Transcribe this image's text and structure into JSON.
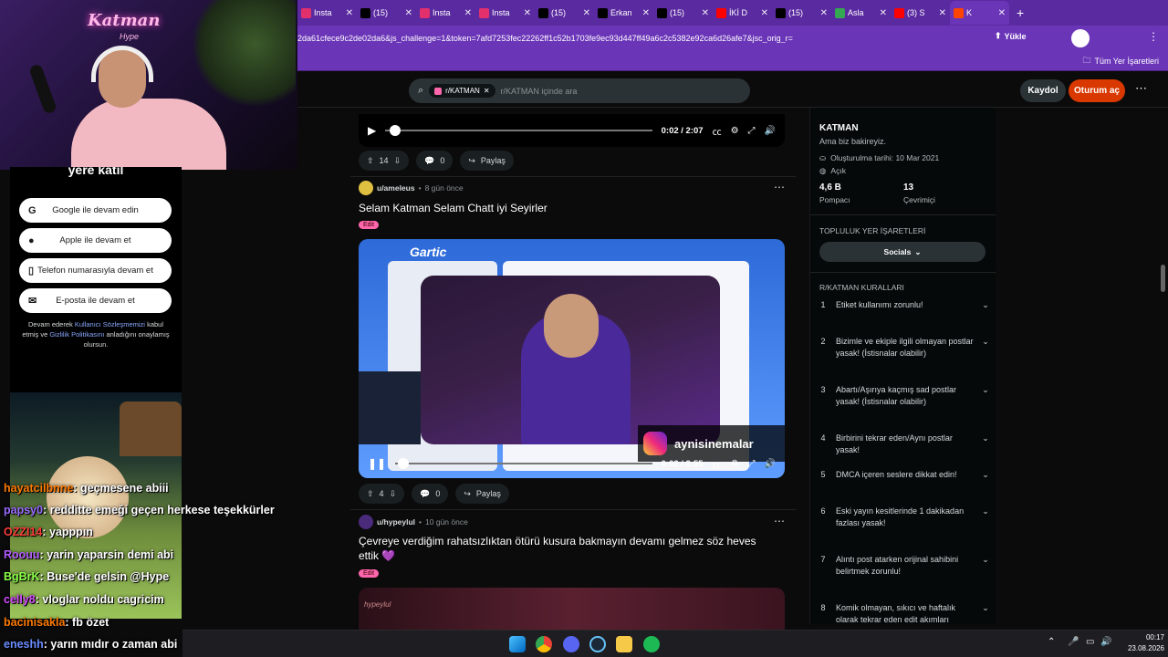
{
  "browser": {
    "tabs": [
      {
        "label": "Insta",
        "icon": "instagram-icon",
        "color": "#e1306c"
      },
      {
        "label": "(15)",
        "icon": "x-icon",
        "color": "#000000"
      },
      {
        "label": "Insta",
        "icon": "instagram-icon",
        "color": "#e1306c"
      },
      {
        "label": "Insta",
        "icon": "instagram-icon",
        "color": "#e1306c"
      },
      {
        "label": "(15)",
        "icon": "x-icon",
        "color": "#000000"
      },
      {
        "label": "Erkan",
        "icon": "tiktok-icon",
        "color": "#000000"
      },
      {
        "label": "(15)",
        "icon": "x-icon",
        "color": "#000000"
      },
      {
        "label": "İKİ D",
        "icon": "youtube-icon",
        "color": "#ff0000"
      },
      {
        "label": "(15)",
        "icon": "x-icon",
        "color": "#000000"
      },
      {
        "label": "Asla",
        "icon": "map-icon",
        "color": "#34a853"
      },
      {
        "label": "(3) S",
        "icon": "youtube-icon",
        "color": "#ff0000"
      },
      {
        "label": "K",
        "icon": "reddit-icon",
        "color": "#ff4500"
      }
    ],
    "url": "2da61cfece9c2de02da6&js_challenge=1&token=7afd7253fec22262ff1c52b1703fe9ec93d447ff49a6c2c5382e92ca6d26afe7&jsc_orig_r=",
    "upload_label": "Yükle",
    "bookmarks_label": "Tüm Yer İşaretleri"
  },
  "header": {
    "search_chip": "r/KATMAN",
    "search_placeholder": "r/KATMAN içinde ara",
    "signup_label": "Kaydol",
    "login_label": "Oturum aç"
  },
  "feed": {
    "top_player": {
      "time": "0:02 / 2:07",
      "progress": 0.016
    },
    "top_actions": {
      "votes": "14",
      "comments": "0",
      "share": "Paylaş"
    },
    "posts": [
      {
        "user": "u/ameleus",
        "age": "8 gün önce",
        "title": "Selam Katman Selam Chatt iyi Seyirler",
        "flair": "Edit",
        "video_watermark": "aynisinemalar",
        "player_time": "0:02 / 3:55",
        "progress": 0.009,
        "votes": "4",
        "comments": "0",
        "share": "Paylaş"
      },
      {
        "user": "u/hypeylul",
        "age": "10 gün önce",
        "title": "Çevreye verdiğim rahatsızlıktan ötürü kusura bakmayın devamı gelmez söz heves ettik 💜",
        "flair": "Edit",
        "preview_label": "hypeylul"
      }
    ]
  },
  "sidebar": {
    "community_name": "KATMAN",
    "tagline": "Ama biz bakireyiz.",
    "created": "Oluşturulma tarihi: 10 Mar 2021",
    "visibility": "Açık",
    "members_value": "4,6 B",
    "members_label": "Pompacı",
    "online_value": "13",
    "online_label": "Çevrimiçi",
    "bookmarks_title": "TOPLULUK YER İŞARETLERİ",
    "socials_label": "Socials",
    "rules_title": "R/KATMAN KURALLARI",
    "rules": [
      {
        "n": "1",
        "text": "Etiket kullanımı zorunlu!"
      },
      {
        "n": "2",
        "text": "Bizimle ve ekiple ilgili olmayan postlar yasak! (İstisnalar olabilir)"
      },
      {
        "n": "3",
        "text": "Abartı/Aşırıya kaçmış sad postlar yasak! (İstisnalar olabilir)"
      },
      {
        "n": "4",
        "text": "Birbirini tekrar eden/Aynı postlar yasak!"
      },
      {
        "n": "5",
        "text": "DMCA içeren seslere dikkat edin!"
      },
      {
        "n": "6",
        "text": "Eski yayın kesitlerinde 1 dakikadan fazlası yasak!"
      },
      {
        "n": "7",
        "text": "Alıntı post atarken orijinal sahibini belirtmek zorunlu!"
      },
      {
        "n": "8",
        "text": "Komik olmayan, sıkıcı ve haftalık olarak tekrar eden edit akımları onaylanmayacak!"
      }
    ]
  },
  "overlay": {
    "channel_logo": "Katman",
    "channel_logo_sub": "Hype",
    "join_heading": "yere katıl",
    "login_buttons": [
      {
        "label": "Google ile devam edin",
        "icon": "google-icon"
      },
      {
        "label": "Apple ile devam et",
        "icon": "apple-icon"
      },
      {
        "label": "Telefon numarasıyla devam et",
        "icon": "phone-icon"
      },
      {
        "label": "E-posta ile devam et",
        "icon": "mail-icon"
      }
    ],
    "terms_1": "Devam ederek",
    "terms_link_1": "Kullanıcı Sözleşmemizi",
    "terms_2": "kabul etmiş ve",
    "terms_link_2": "Gizlilik Politikasını",
    "terms_3": "anladığını onaylamış olursun.",
    "chat": [
      {
        "user": "hayatcilbnne",
        "msg": ": geçmesene abiii",
        "color": "#ff7a00"
      },
      {
        "user": "papsy0",
        "msg": ": redditte emeği geçen herkese teşekkürler",
        "color": "#9a6bff"
      },
      {
        "user": "OZZI14",
        "msg": ": yapppın",
        "color": "#ff3b3b"
      },
      {
        "user": "Roouu",
        "msg": ": yarin yaparsin demi abi",
        "color": "#b25cff"
      },
      {
        "user": "BgBrK",
        "msg": ": Buse'de gelsin @Hype",
        "color": "#8bff4a"
      },
      {
        "user": "celly8",
        "msg": ": vloglar noldu cagricim",
        "color": "#d44cff"
      },
      {
        "user": "bacinisakla",
        "msg": ": fb özet",
        "color": "#ff7a00"
      },
      {
        "user": "eneshh",
        "msg": ": yarın mıdır o zaman abi",
        "color": "#6a8cff"
      }
    ]
  },
  "taskbar": {
    "time": "00:17",
    "date": "23.08.2026"
  }
}
